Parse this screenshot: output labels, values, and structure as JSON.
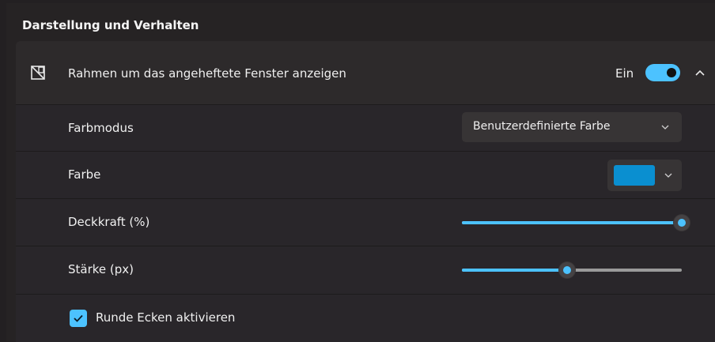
{
  "section": {
    "title": "Darstellung und Verhalten"
  },
  "border_setting": {
    "icon": "window-frame-icon",
    "label": "Rahmen um das angeheftete Fenster anzeigen",
    "toggle_state": "Ein",
    "toggle_on": true,
    "expanded": true
  },
  "color_mode": {
    "label": "Farbmodus",
    "selected": "Benutzerdefinierte Farbe"
  },
  "color": {
    "label": "Farbe",
    "value": "#0a8fd0"
  },
  "opacity": {
    "label": "Deckkraft (%)",
    "value_fraction": 1.0
  },
  "thickness": {
    "label": "Stärke (px)",
    "value_fraction": 0.48
  },
  "rounded_corners": {
    "label": "Runde Ecken aktivieren",
    "checked": true
  },
  "accent_color": "#4cc2ff"
}
